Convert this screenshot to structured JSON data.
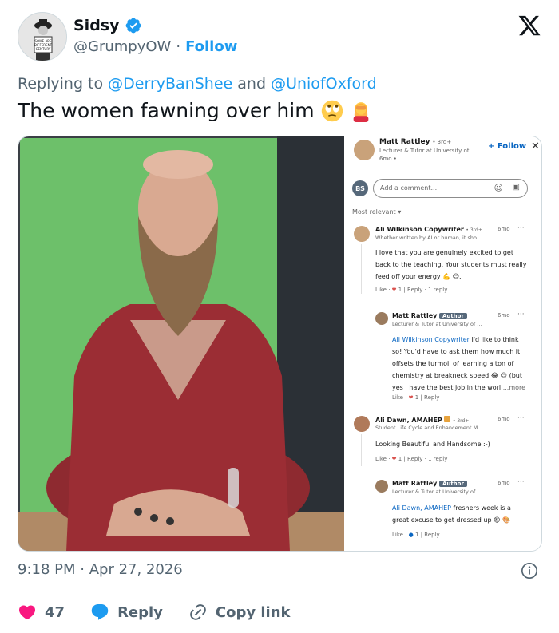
{
  "author": {
    "display_name": "Sidsy",
    "handle": "@GrumpyOW",
    "separator": "·",
    "follow_label": "Follow",
    "avatar_sign_text": "SOME ARE DIFFERENT CENTURY"
  },
  "reply": {
    "prefix": "Replying to",
    "mention1": "@DerryBanShee",
    "conjunction": "and",
    "mention2": "@UniofOxford"
  },
  "tweet": {
    "text": "The women fawning over him",
    "emojis": [
      "face-with-rolling-eyes",
      "woman-facepalming"
    ]
  },
  "media": {
    "linkedin": {
      "post_author": "Matt Rattley",
      "post_author_degree": "• 3rd+",
      "post_author_title": "Lecturer & Tutor at University of ...",
      "post_age": "6mo •",
      "follow_label": "+ Follow",
      "input_avatar": "BS",
      "input_placeholder": "Add a comment...",
      "sort_label": "Most relevant",
      "comments": [
        {
          "name": "Ali Wilkinson Copywriter",
          "degree": "• 3rd+",
          "subtitle": "Whether written by AI or human, it sho...",
          "age": "6mo",
          "lines": [
            "I love that you are genuinely excited to get",
            "back to the teaching. Your students must really",
            "feed off your energy"
          ],
          "like_label": "Like",
          "like_count": "1",
          "reply_label": "Reply",
          "reply_count": "1 reply"
        },
        {
          "name": "Matt Rattley",
          "badge": "Author",
          "subtitle": "Lecturer & Tutor at University of ...",
          "age": "6mo",
          "mention": "Ali Wilkinson Copywriter",
          "lines": [
            "I'd like to think",
            "so! You'd have to ask them how much it",
            "offsets the turmoil of learning a ton of",
            "chemistry at breakneck speed",
            "(but",
            "yes I have the best job in the worl"
          ],
          "more_label": "...more",
          "like_label": "Like",
          "like_count": "1",
          "reply_label": "Reply"
        },
        {
          "name": "Ali Dawn, AMAHEP",
          "degree": "• 3rd+",
          "subtitle": "Student Life Cycle and Enhancement M...",
          "age": "6mo",
          "lines": [
            "Looking Beautiful and Handsome :-)"
          ],
          "like_label": "Like",
          "like_count": "1",
          "reply_label": "Reply",
          "reply_count": "1 reply"
        },
        {
          "name": "Matt Rattley",
          "badge": "Author",
          "subtitle": "Lecturer & Tutor at University of ...",
          "age": "6mo",
          "mention": "Ali Dawn, AMAHEP",
          "lines": [
            "freshers week is a",
            "great excuse to get dressed up"
          ],
          "like_label": "Like",
          "like_count": "1",
          "reply_label": "Reply"
        }
      ]
    }
  },
  "footer": {
    "time": "9:18 PM",
    "separator": "·",
    "date": "Apr 27, 2026",
    "like_count": "47",
    "reply_label": "Reply",
    "copy_label": "Copy link"
  },
  "colors": {
    "accent": "#1d9bf0",
    "like_red": "#f91880",
    "muted": "#536471",
    "linkedin_blue": "#0a66c2"
  },
  "icons": [
    "verified-badge-icon",
    "x-logo-icon",
    "info-icon",
    "heart-icon",
    "reply-bubble-icon",
    "link-icon"
  ]
}
